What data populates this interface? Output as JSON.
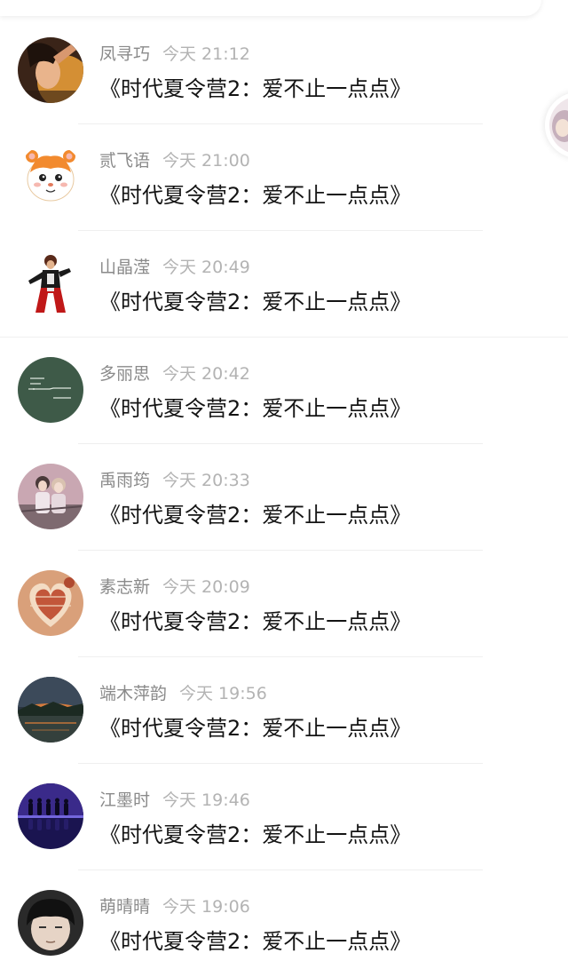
{
  "messages": [
    {
      "name": "凤寻巧",
      "time": "今天 21:12",
      "text": "《时代夏令营2：爱不止一点点》",
      "avatar": "avatar-woman-portrait-icon"
    },
    {
      "name": "贰飞语",
      "time": "今天 21:00",
      "text": "《时代夏令营2：爱不止一点点》",
      "avatar": "avatar-hamster-cartoon-icon"
    },
    {
      "name": "山晶滢",
      "time": "今天 20:49",
      "text": "《时代夏令营2：爱不止一点点》",
      "avatar": "avatar-fighter-character-icon"
    },
    {
      "name": "多丽思",
      "time": "今天 20:42",
      "text": "《时代夏令营2：爱不止一点点》",
      "avatar": "avatar-chalkboard-icon"
    },
    {
      "name": "禹雨筠",
      "time": "今天 20:33",
      "text": "《时代夏令营2：爱不止一点点》",
      "avatar": "avatar-two-girls-photo-icon"
    },
    {
      "name": "素志新",
      "time": "今天 20:09",
      "text": "《时代夏令营2：爱不止一点点》",
      "avatar": "avatar-candy-hearts-icon"
    },
    {
      "name": "端木萍韵",
      "time": "今天 19:56",
      "text": "《时代夏令营2：爱不止一点点》",
      "avatar": "avatar-sunset-landscape-icon"
    },
    {
      "name": "江墨时",
      "time": "今天 19:46",
      "text": "《时代夏令营2：爱不止一点点》",
      "avatar": "avatar-group-silhouette-icon"
    },
    {
      "name": "萌晴晴",
      "time": "今天 19:06",
      "text": "《时代夏令营2：爱不止一点点》",
      "avatar": "avatar-boy-portrait-icon"
    }
  ],
  "colors": {
    "name": "#8a8a8a",
    "time": "#b3b3b3",
    "message": "#141414",
    "divider": "#efefef"
  }
}
